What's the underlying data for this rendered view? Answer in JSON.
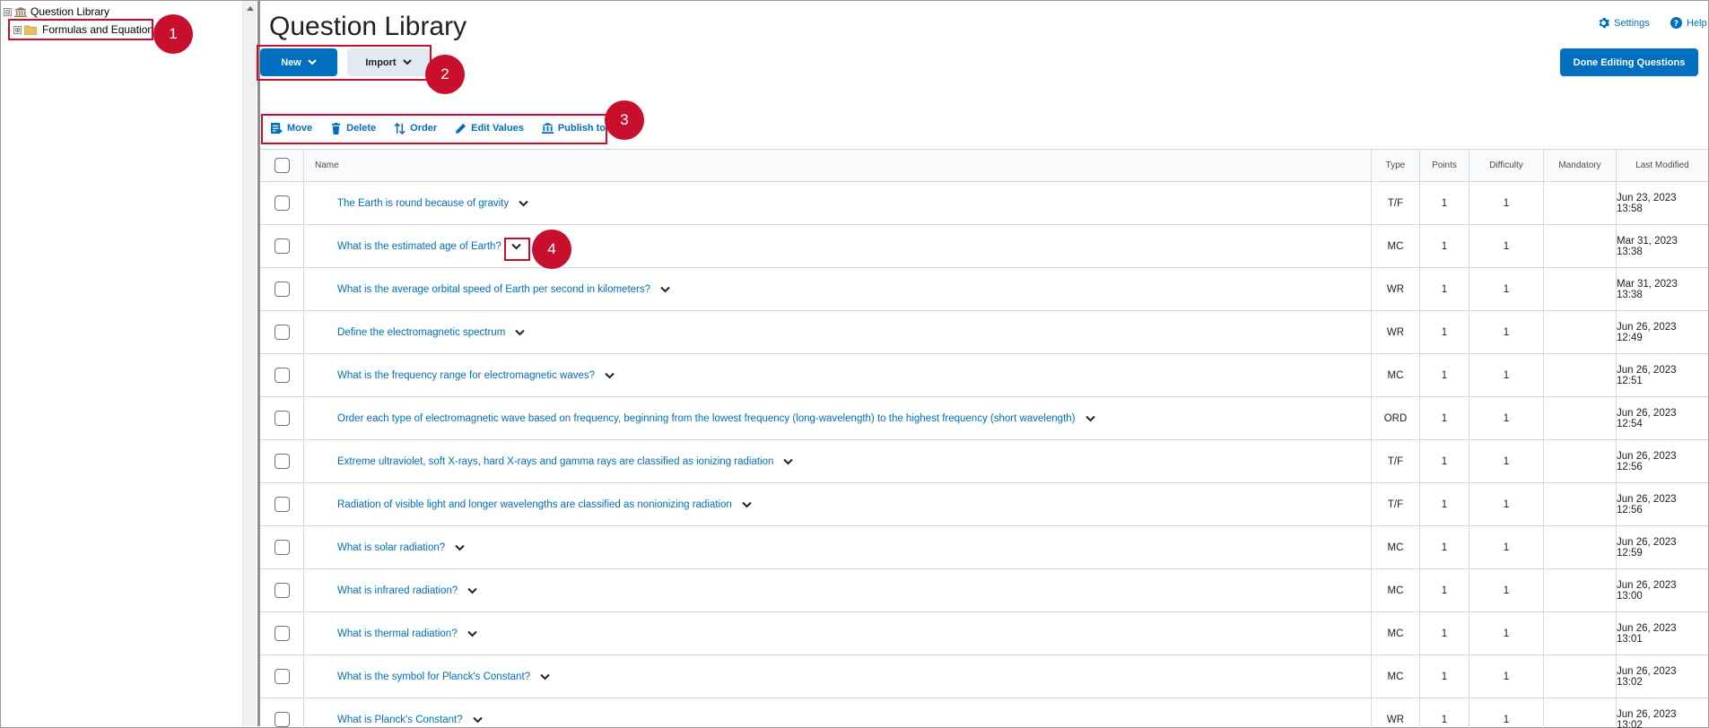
{
  "tree": {
    "root_label": "Question Library",
    "child_label": "Formulas and Equations",
    "toggle_symbol": "⊟",
    "child_toggle_symbol": "⊞"
  },
  "callouts": [
    "1",
    "2",
    "3",
    "4"
  ],
  "header": {
    "title": "Question Library",
    "settings_label": "Settings",
    "help_label": "Help"
  },
  "buttons": {
    "new_label": "New",
    "import_label": "Import",
    "done_label": "Done Editing Questions"
  },
  "actions": {
    "move": "Move",
    "delete": "Delete",
    "order": "Order",
    "edit_values": "Edit Values",
    "publish": "Publish to LOR"
  },
  "table": {
    "columns": {
      "name": "Name",
      "type": "Type",
      "points": "Points",
      "difficulty": "Difficulty",
      "mandatory": "Mandatory",
      "last_modified": "Last Modified"
    },
    "rows": [
      {
        "name": "The Earth is round because of gravity",
        "type": "T/F",
        "points": "1",
        "difficulty": "1",
        "mandatory": "",
        "modified": "Jun 23, 2023 13:58"
      },
      {
        "name": "What is the estimated age of Earth?",
        "type": "MC",
        "points": "1",
        "difficulty": "1",
        "mandatory": "",
        "modified": "Mar 31, 2023 13:38"
      },
      {
        "name": "What is the average orbital speed of Earth per second in kilometers?",
        "type": "WR",
        "points": "1",
        "difficulty": "1",
        "mandatory": "",
        "modified": "Mar 31, 2023 13:38"
      },
      {
        "name": "Define the electromagnetic spectrum",
        "type": "WR",
        "points": "1",
        "difficulty": "1",
        "mandatory": "",
        "modified": "Jun 26, 2023 12:49"
      },
      {
        "name": "What is the frequency range for electromagnetic waves?",
        "type": "MC",
        "points": "1",
        "difficulty": "1",
        "mandatory": "",
        "modified": "Jun 26, 2023 12:51"
      },
      {
        "name": "Order each type of electromagnetic wave based on frequency, beginning from the lowest frequency (long-wavelength) to the highest frequency (short wavelength)",
        "type": "ORD",
        "points": "1",
        "difficulty": "1",
        "mandatory": "",
        "modified": "Jun 26, 2023 12:54"
      },
      {
        "name": "Extreme ultraviolet, soft X-rays, hard X-rays and gamma rays are classified as ionizing radiation",
        "type": "T/F",
        "points": "1",
        "difficulty": "1",
        "mandatory": "",
        "modified": "Jun 26, 2023 12:56"
      },
      {
        "name": "Radiation of visible light and longer wavelengths are classified as nonionizing radiation",
        "type": "T/F",
        "points": "1",
        "difficulty": "1",
        "mandatory": "",
        "modified": "Jun 26, 2023 12:56"
      },
      {
        "name": "What is solar radiation?",
        "type": "MC",
        "points": "1",
        "difficulty": "1",
        "mandatory": "",
        "modified": "Jun 26, 2023 12:59"
      },
      {
        "name": "What is infrared radiation?",
        "type": "MC",
        "points": "1",
        "difficulty": "1",
        "mandatory": "",
        "modified": "Jun 26, 2023 13:00"
      },
      {
        "name": "What is thermal radiation?",
        "type": "MC",
        "points": "1",
        "difficulty": "1",
        "mandatory": "",
        "modified": "Jun 26, 2023 13:01"
      },
      {
        "name": "What is the symbol for Planck's Constant?",
        "type": "MC",
        "points": "1",
        "difficulty": "1",
        "mandatory": "",
        "modified": "Jun 26, 2023 13:02"
      },
      {
        "name": "What is Planck's Constant?",
        "type": "WR",
        "points": "1",
        "difficulty": "1",
        "mandatory": "",
        "modified": "Jun 26, 2023 13:02"
      }
    ]
  },
  "colors": {
    "accent": "#006fbf",
    "callout": "#c8102e",
    "secondary_button": "#e3e9f1"
  }
}
